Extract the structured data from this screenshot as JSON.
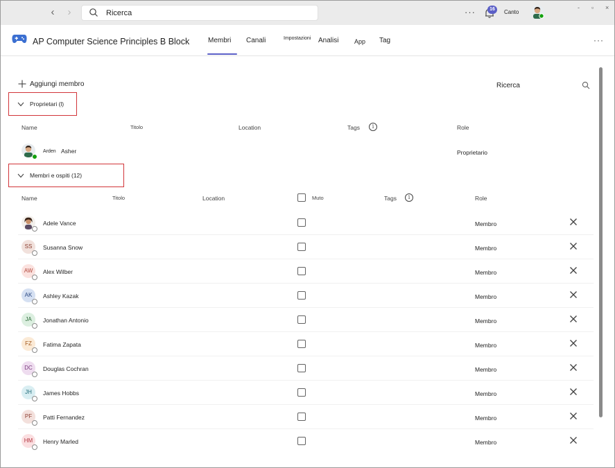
{
  "titlebar": {
    "search_value": "Ricerca",
    "more_label": "···",
    "notification_count": "16",
    "user_name": "Canto",
    "win_minimize": "-",
    "win_restore": "▫",
    "win_close": "×"
  },
  "header": {
    "team_name": "AP Computer Science Principles B Block",
    "tabs": [
      "Membri",
      "Canali",
      "Impostazioni",
      "Analisi",
      "App",
      "Tag"
    ],
    "more_label": "···"
  },
  "toolbar": {
    "add_member_label": "Aggiungi membro",
    "search_label": "Ricerca"
  },
  "owners": {
    "section_label": "Proprietari (l)",
    "columns": [
      "Name",
      "Titolo",
      "Location",
      "Tags",
      "Role"
    ],
    "rows": [
      {
        "first": "Arden",
        "last": "Asher",
        "role": "Proprietario"
      }
    ]
  },
  "members": {
    "section_label": "Membri e ospiti (12)",
    "columns": [
      "Name",
      "Titolo",
      "Location",
      "Muto",
      "Tags",
      "Role"
    ],
    "rows": [
      {
        "name": "Adele Vance",
        "initials": "",
        "role": "Membro",
        "avatar_bg": "#ffffff",
        "avatar_fg": "#242424"
      },
      {
        "name": "Susanna Snow",
        "initials": "SS",
        "role": "Membro",
        "avatar_bg": "#f1e1dc",
        "avatar_fg": "#8a3c2e"
      },
      {
        "name": "Alex Wilber",
        "initials": "AW",
        "role": "Membro",
        "avatar_bg": "#fbe2df",
        "avatar_fg": "#b34a3f"
      },
      {
        "name": "Ashley Kazak",
        "initials": "AK",
        "role": "Membro",
        "avatar_bg": "#d5e0f2",
        "avatar_fg": "#2c4a84"
      },
      {
        "name": "Jonathan Antonio",
        "initials": "JA",
        "role": "Membro",
        "avatar_bg": "#dcefe0",
        "avatar_fg": "#2d6b3a"
      },
      {
        "name": "Fatima Zapata",
        "initials": "FZ",
        "role": "Membro",
        "avatar_bg": "#fbead6",
        "avatar_fg": "#a2591b"
      },
      {
        "name": "Douglas Cochran",
        "initials": "DC",
        "role": "Membro",
        "avatar_bg": "#eedcef",
        "avatar_fg": "#7a3b7e"
      },
      {
        "name": "James Hobbs",
        "initials": "JH",
        "role": "Membro",
        "avatar_bg": "#d9eef2",
        "avatar_fg": "#1f6a78"
      },
      {
        "name": "Patti Fernandez",
        "initials": "PF",
        "role": "Membro",
        "avatar_bg": "#f3e0dc",
        "avatar_fg": "#8e3f33"
      },
      {
        "name": "Henry Marled",
        "initials": "HM",
        "role": "Membro",
        "avatar_bg": "#fbdfe1",
        "avatar_fg": "#b2343e"
      }
    ]
  },
  "colors": {
    "accent": "#5b5fc7",
    "highlight_border": "#d13438",
    "presence_green": "#13a10e"
  }
}
